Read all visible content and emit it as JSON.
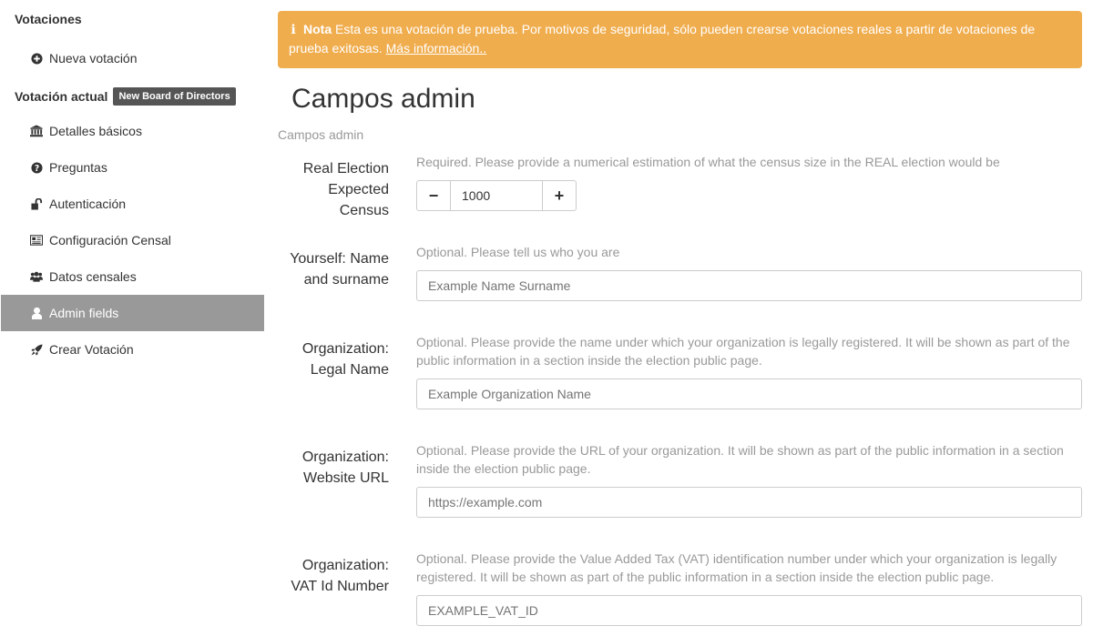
{
  "sidebar": {
    "heading_votaciones": "Votaciones",
    "nueva_votacion": "Nueva votación",
    "heading_actual": "Votación actual",
    "current_badge": "New Board of Directors",
    "items": [
      {
        "label": "Detalles básicos",
        "icon": "bank-icon"
      },
      {
        "label": "Preguntas",
        "icon": "question-circle-icon"
      },
      {
        "label": "Autenticación",
        "icon": "unlock-icon"
      },
      {
        "label": "Configuración Censal",
        "icon": "newspaper-icon"
      },
      {
        "label": "Datos censales",
        "icon": "users-icon"
      },
      {
        "label": "Admin fields",
        "icon": "user-icon",
        "active": true
      },
      {
        "label": "Crear Votación",
        "icon": "rocket-icon"
      }
    ],
    "active_color": "#999999"
  },
  "notice": {
    "bold": "Nota",
    "text": " Esta es una votación de prueba. Por motivos de seguridad, sólo pueden crearse votaciones reales a partir de votaciones de prueba exitosas. ",
    "link": "Más información..",
    "color": "#f0ad4e"
  },
  "main": {
    "title": "Campos admin",
    "section_label": "Campos admin"
  },
  "fields": {
    "census": {
      "label": "Real Election Expected Census",
      "help": "Required. Please provide a numerical estimation of what the census size in the REAL election would be",
      "value": "1000",
      "minus": "−",
      "plus": "+"
    },
    "name": {
      "label": "Yourself: Name and surname",
      "help": "Optional. Please tell us who you are",
      "placeholder": "Example Name Surname"
    },
    "org_name": {
      "label": "Organization: Legal Name",
      "help": "Optional. Please provide the name under which your organization is legally registered. It will be shown as part of the public information in a section inside the election public page.",
      "placeholder": "Example Organization Name"
    },
    "org_url": {
      "label": "Organization: Website URL",
      "help": "Optional. Please provide the URL of your organization. It will be shown as part of the public information in a section inside the election public page.",
      "placeholder": "https://example.com"
    },
    "org_vat": {
      "label": "Organization: VAT Id Number",
      "help": "Optional. Please provide the Value Added Tax (VAT) identification number under which your organization is legally registered. It will be shown as part of the public information in a section inside the election public page.",
      "placeholder": "EXAMPLE_VAT_ID"
    }
  }
}
